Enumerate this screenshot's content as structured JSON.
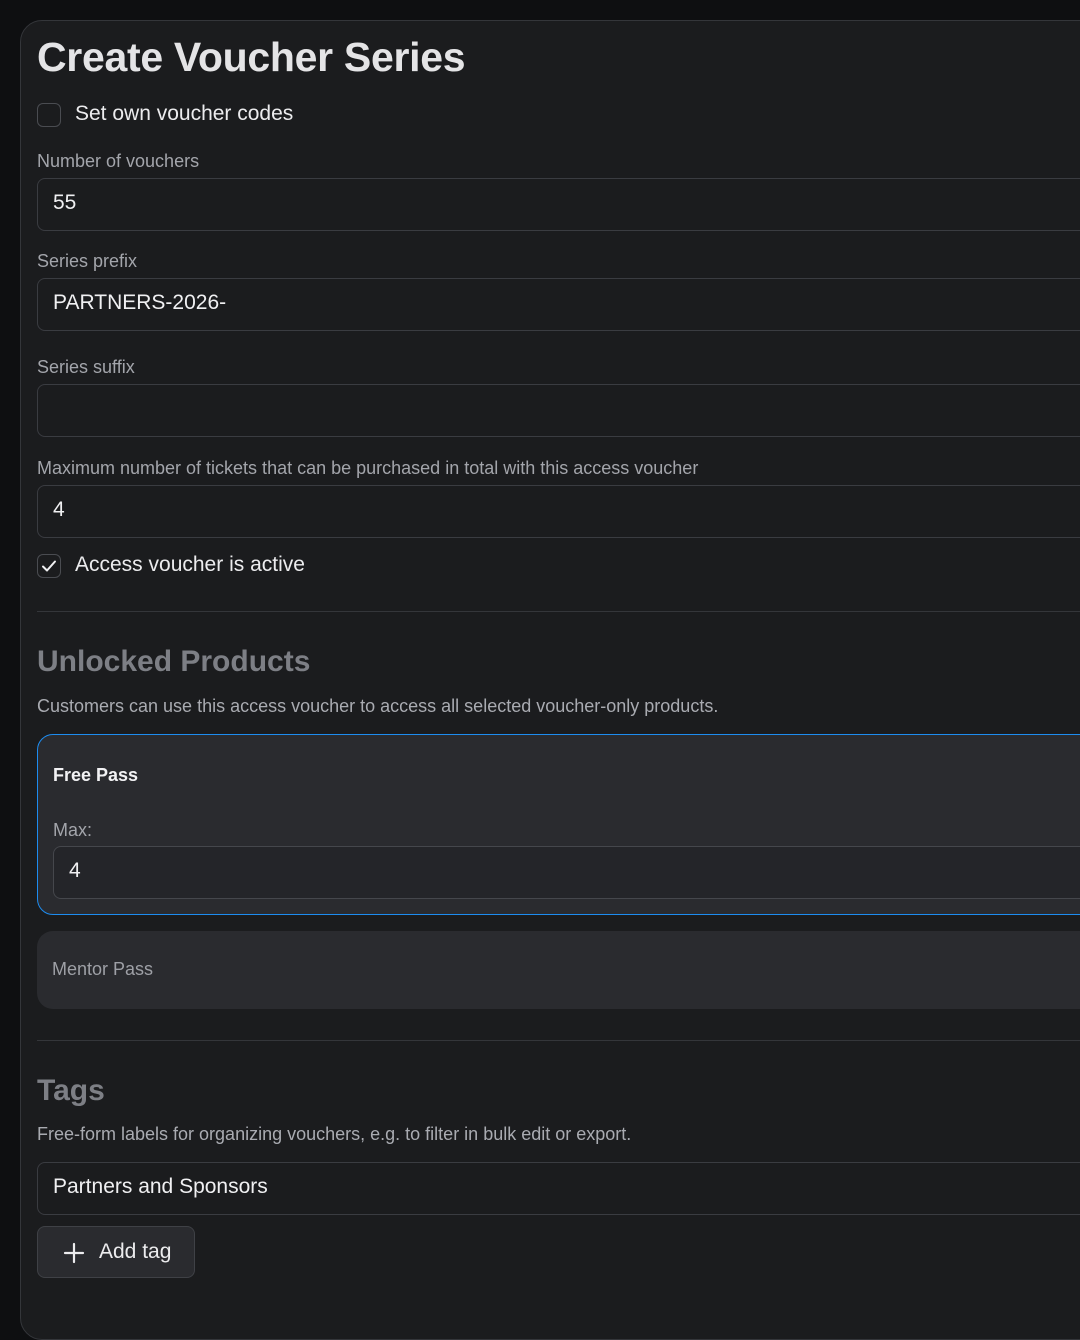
{
  "form": {
    "title": "Create Voucher Series",
    "set_own_codes": {
      "label": "Set own voucher codes",
      "checked": false
    },
    "number_of_vouchers": {
      "label": "Number of vouchers",
      "value": "55"
    },
    "series_prefix": {
      "label": "Series prefix",
      "value": "PARTNERS-2026-"
    },
    "series_suffix": {
      "label": "Series suffix",
      "value": ""
    },
    "max_tickets": {
      "label": "Maximum number of tickets that can be purchased in total with this access voucher",
      "value": "4"
    },
    "active": {
      "label": "Access voucher is active",
      "checked": true
    }
  },
  "unlocked_products": {
    "title": "Unlocked Products",
    "description": "Customers can use this access voucher to access all selected voucher-only products.",
    "items": [
      {
        "name": "Free Pass",
        "selected": true,
        "max_label": "Max:",
        "max_value": "4"
      },
      {
        "name": "Mentor Pass",
        "selected": false
      }
    ]
  },
  "tags": {
    "title": "Tags",
    "description": "Free-form labels for organizing vouchers, e.g. to filter in bulk edit or export.",
    "items": [
      "Partners and Sponsors"
    ],
    "add_label": "Add tag"
  },
  "colors": {
    "page_background": "#0e0f11",
    "panel_background": "#1b1c1e",
    "selected_border": "#1d8cf0",
    "card_background": "#2a2b2f"
  },
  "icons": {
    "checkmark": "check-icon",
    "add": "plus-icon"
  }
}
